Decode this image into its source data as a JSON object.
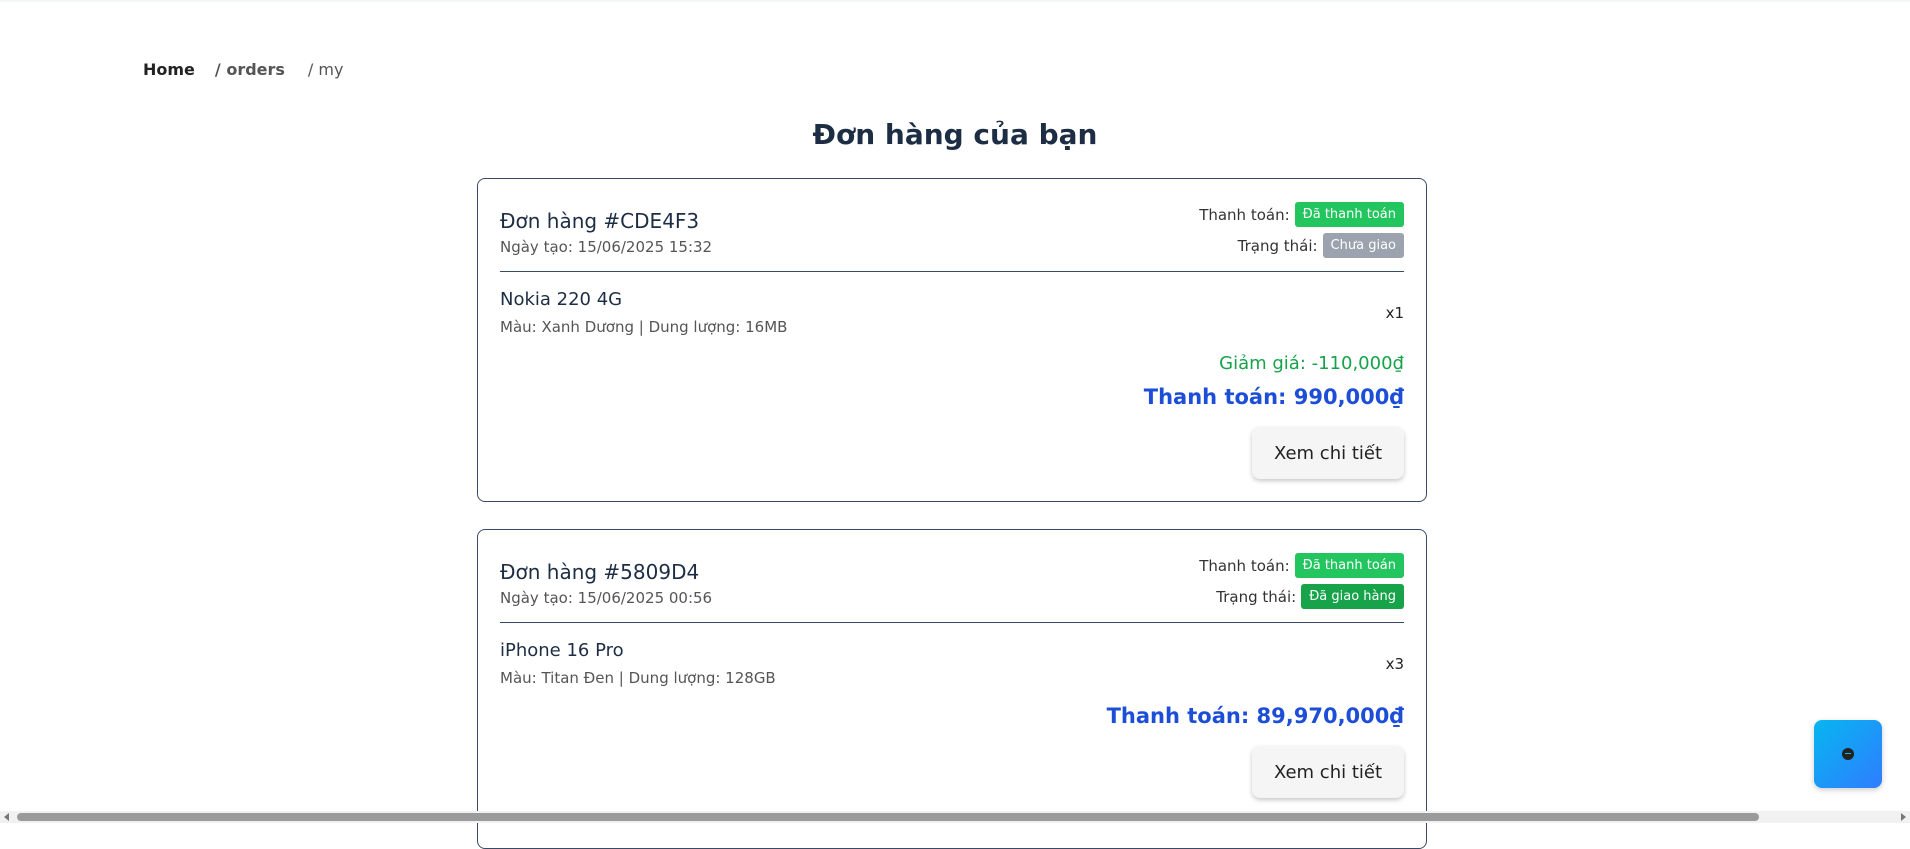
{
  "breadcrumb": {
    "home": "Home",
    "orders": "/ orders",
    "current": "/ my"
  },
  "page_title": "Đơn hàng của bạn",
  "orders": [
    {
      "id": "Đơn hàng #CDE4F3",
      "date": "Ngày tạo: 15/06/2025 15:32",
      "payment_label": "Thanh toán:",
      "payment_status": "Đã thanh toán",
      "status_label": "Trạng thái:",
      "delivery_status": "Chưa giao",
      "item": {
        "name": "Nokia 220 4G",
        "desc": "Màu: Xanh Dương | Dung lượng: 16MB",
        "qty": "x1"
      },
      "discount": "Giảm giá: -110,000₫",
      "total": "Thanh toán: 990,000₫",
      "button": "Xem chi tiết"
    },
    {
      "id": "Đơn hàng #5809D4",
      "date": "Ngày tạo: 15/06/2025 00:56",
      "payment_label": "Thanh toán:",
      "payment_status": "Đã thanh toán",
      "status_label": "Trạng thái:",
      "delivery_status": "Đã giao hàng",
      "item": {
        "name": "iPhone 16 Pro",
        "desc": "Màu: Titan Đen | Dung lượng: 128GB",
        "qty": "x3"
      },
      "total": "Thanh toán: 89,970,000₫",
      "button": "Xem chi tiết"
    }
  ],
  "colors": {
    "paid": "#22c55e",
    "not_delivered": "#9ca3af",
    "delivered": "#16a34a",
    "discount": "#16a34a",
    "total": "#1d4ed8"
  },
  "chat_button": {
    "icon": "chat-icon"
  }
}
